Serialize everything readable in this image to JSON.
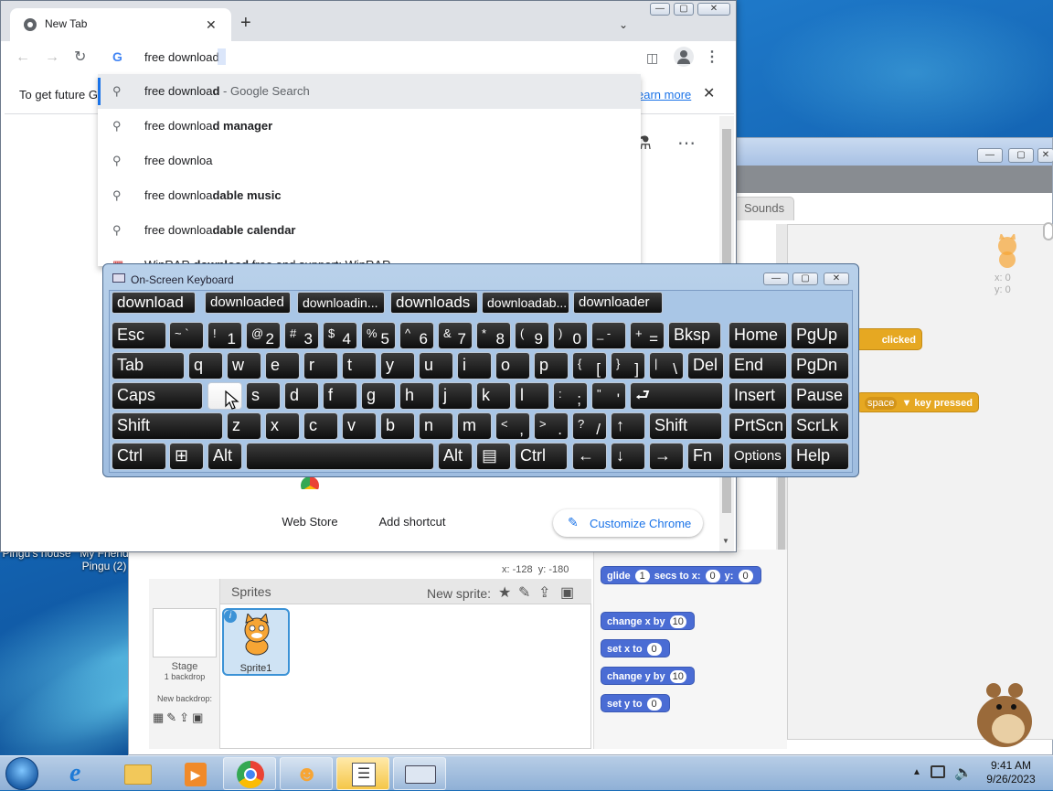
{
  "desktop": {
    "icons": [
      {
        "label": "Pingu's house"
      },
      {
        "label": "My Friend Pingu (2)"
      }
    ]
  },
  "scratch": {
    "tabs": [
      "Sounds"
    ],
    "stage_sprite": {
      "x_label": "x: 0",
      "y_label": "y: 0"
    },
    "coords": {
      "x": "x: -128",
      "y": "y: -180"
    },
    "sprites_header": "Sprites",
    "new_sprite_label": "New sprite:",
    "stage": {
      "label": "Stage",
      "sub": "1 backdrop",
      "new_backdrop": "New backdrop:"
    },
    "sprite1": {
      "name": "Sprite1"
    },
    "scripts": {
      "clicked": "clicked",
      "key_value": "space",
      "key_label": "key pressed"
    },
    "blocks": {
      "glide": {
        "a": "glide",
        "v1": "1",
        "b": "secs to x:",
        "v2": "0",
        "c": "y:",
        "v3": "0"
      },
      "change_x": {
        "a": "change",
        "b": "x",
        "c": "by",
        "v": "10"
      },
      "set_x": {
        "a": "set",
        "b": "x",
        "c": "to",
        "v": "0"
      },
      "change_y": {
        "a": "change",
        "b": "y",
        "c": "by",
        "v": "10"
      },
      "set_y": {
        "a": "set",
        "b": "y",
        "c": "to",
        "v": "0"
      }
    }
  },
  "chrome": {
    "tab_title": "New Tab",
    "omnibox_value": "free download",
    "infobar_text": "To get future G",
    "infobar_link": "earn more",
    "suggestions": [
      {
        "pre": "free downloa",
        "bold": "d",
        "post": " - Google Search"
      },
      {
        "pre": "free downloa",
        "bold": "d manager",
        "post": ""
      },
      {
        "pre": "free downloa",
        "bold": "",
        "post": ""
      },
      {
        "pre": "free downloa",
        "bold": "dable music",
        "post": ""
      },
      {
        "pre": "free downloa",
        "bold": "dable calendar",
        "post": ""
      },
      {
        "pre": "WinRAR ",
        "bold": "download",
        "post": " free and support: WinRAR"
      }
    ],
    "shortcuts": [
      "Web Store",
      "Add shortcut"
    ],
    "customize": "Customize Chrome"
  },
  "osk": {
    "title": "On-Screen Keyboard",
    "predictions": [
      "download",
      "downloaded",
      "downloadin...",
      "downloads",
      "downloadab...",
      "downloader"
    ]
  },
  "taskbar": {
    "time": "9:41 AM",
    "date": "9/26/2023"
  },
  "colors": {
    "accent": "#1a73e8",
    "scratch_blue": "#4a6cd4",
    "osk_bg": "#a9c6e6"
  }
}
